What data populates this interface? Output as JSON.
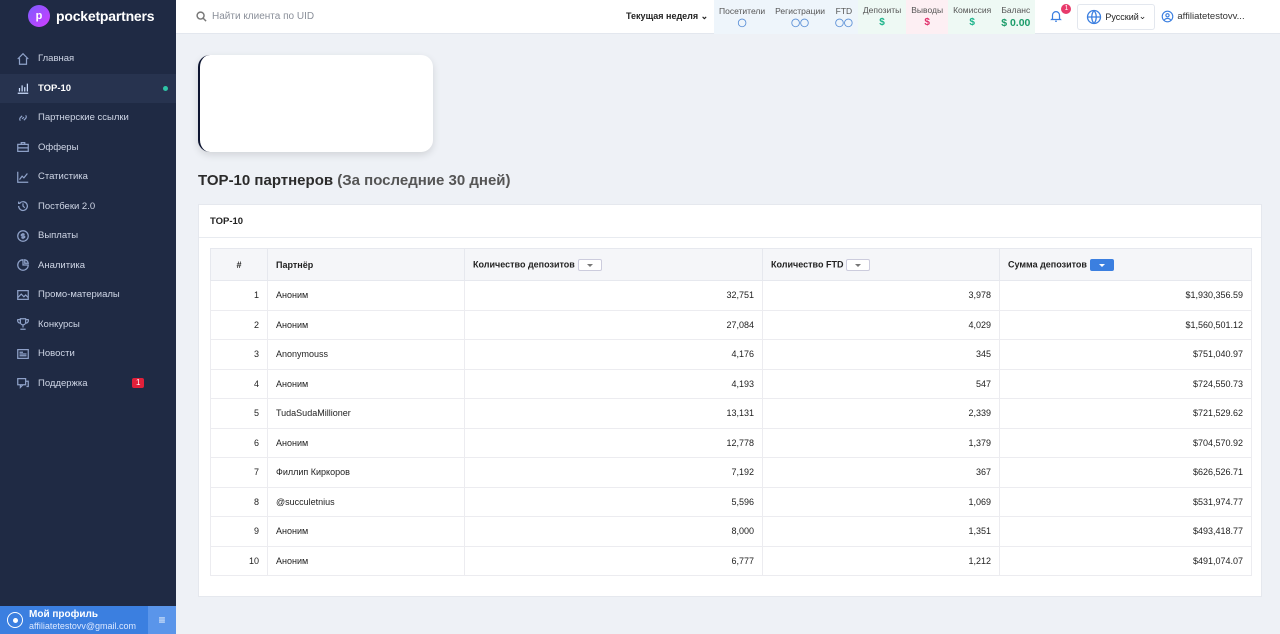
{
  "brand": {
    "name": "pocketpartners"
  },
  "sidebar": {
    "items": [
      {
        "label": "Главная",
        "icon": "home-icon"
      },
      {
        "label": "TOP-10",
        "icon": "chart-bars-icon",
        "active": true
      },
      {
        "label": "Партнерские ссылки",
        "icon": "link-icon"
      },
      {
        "label": "Офферы",
        "icon": "briefcase-icon"
      },
      {
        "label": "Статистика",
        "icon": "line-chart-icon"
      },
      {
        "label": "Постбеки 2.0",
        "icon": "history-icon"
      },
      {
        "label": "Выплаты",
        "icon": "dollar-circle-icon"
      },
      {
        "label": "Аналитика",
        "icon": "pie-chart-icon"
      },
      {
        "label": "Промо-материалы",
        "icon": "image-icon"
      },
      {
        "label": "Конкурсы",
        "icon": "trophy-icon"
      },
      {
        "label": "Новости",
        "icon": "newspaper-icon"
      },
      {
        "label": "Поддержка",
        "icon": "support-icon",
        "badge": "1"
      }
    ],
    "profile": {
      "title": "Мой профиль",
      "email": "affiliatetestovv@gmail.com"
    }
  },
  "header": {
    "search_placeholder": "Найти клиента по UID",
    "period": "Текущая неделя",
    "stats": [
      {
        "label": "Посетители",
        "icon": "👤"
      },
      {
        "label": "Регистрации",
        "icon": "👥"
      },
      {
        "label": "FTD",
        "icon": "👥"
      },
      {
        "label": "Депозиты",
        "icon": "$"
      },
      {
        "label": "Выводы",
        "icon": "$"
      },
      {
        "label": "Комиссия",
        "icon": "$"
      },
      {
        "label": "Баланс",
        "icon": "$ 0.00"
      }
    ],
    "notifications_badge": "1",
    "language": "Русский",
    "user": "affiliatetestovv..."
  },
  "main": {
    "title_bold": "TOP-10 партнеров",
    "title_rest": "(За последние 30 дней)",
    "card_title": "TOP-10",
    "table": {
      "columns": [
        "#",
        "Партнёр",
        "Количество депозитов",
        "Количество FTD",
        "Сумма депозитов"
      ],
      "rows": [
        [
          "1",
          "Аноним",
          "32,751",
          "3,978",
          "$1,930,356.59"
        ],
        [
          "2",
          "Аноним",
          "27,084",
          "4,029",
          "$1,560,501.12"
        ],
        [
          "3",
          "Anonymouss",
          "4,176",
          "345",
          "$751,040.97"
        ],
        [
          "4",
          "Аноним",
          "4,193",
          "547",
          "$724,550.73"
        ],
        [
          "5",
          "TudaSudaMillioner",
          "13,131",
          "2,339",
          "$721,529.62"
        ],
        [
          "6",
          "Аноним",
          "12,778",
          "1,379",
          "$704,570.92"
        ],
        [
          "7",
          "Филлип Киркоров",
          "7,192",
          "367",
          "$626,526.71"
        ],
        [
          "8",
          "@succuletnius",
          "5,596",
          "1,069",
          "$531,974.77"
        ],
        [
          "9",
          "Аноним",
          "8,000",
          "1,351",
          "$493,418.77"
        ],
        [
          "10",
          "Аноним",
          "6,777",
          "1,212",
          "$491,074.07"
        ]
      ]
    }
  }
}
